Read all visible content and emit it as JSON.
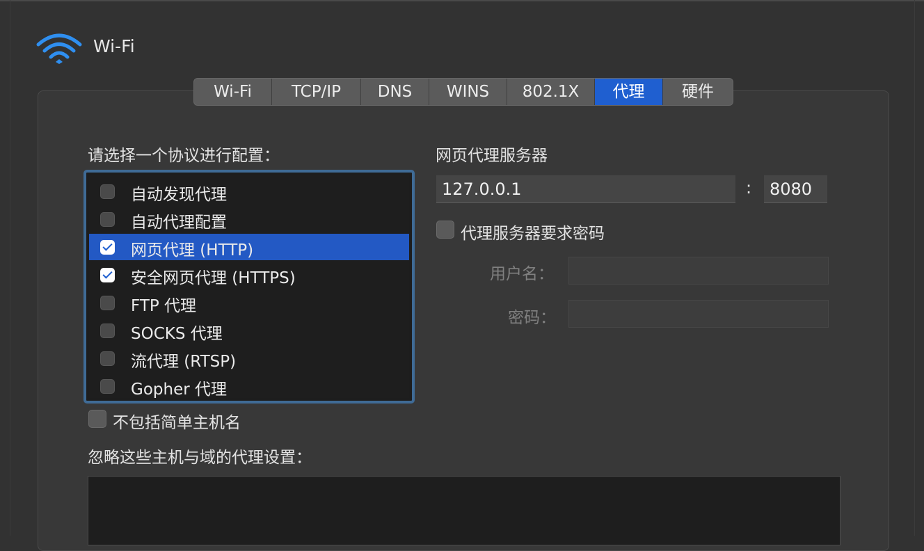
{
  "header": {
    "title": "Wi-Fi",
    "icon": "wifi-icon",
    "accent": "#2f8ff0"
  },
  "tabs": [
    {
      "label": "Wi-Fi",
      "active": false
    },
    {
      "label": "TCP/IP",
      "active": false
    },
    {
      "label": "DNS",
      "active": false
    },
    {
      "label": "WINS",
      "active": false
    },
    {
      "label": "802.1X",
      "active": false
    },
    {
      "label": "代理",
      "active": true
    },
    {
      "label": "硬件",
      "active": false
    }
  ],
  "protocols": {
    "heading": "请选择一个协议进行配置：",
    "items": [
      {
        "label": "自动发现代理",
        "checked": false,
        "selected": false
      },
      {
        "label": "自动代理配置",
        "checked": false,
        "selected": false
      },
      {
        "label": "网页代理 (HTTP)",
        "checked": true,
        "selected": true
      },
      {
        "label": "安全网页代理 (HTTPS)",
        "checked": true,
        "selected": false
      },
      {
        "label": "FTP 代理",
        "checked": false,
        "selected": false
      },
      {
        "label": "SOCKS 代理",
        "checked": false,
        "selected": false
      },
      {
        "label": "流代理 (RTSP)",
        "checked": false,
        "selected": false
      },
      {
        "label": "Gopher 代理",
        "checked": false,
        "selected": false
      }
    ]
  },
  "exclude_simple": {
    "label": "不包括简单主机名",
    "checked": false
  },
  "bypass": {
    "heading": "忽略这些主机与域的代理设置：",
    "value": ""
  },
  "proxy_server": {
    "heading": "网页代理服务器",
    "host": "127.0.0.1",
    "separator": ":",
    "port": "8080",
    "requires_password": {
      "label": "代理服务器要求密码",
      "checked": false
    },
    "username_label": "用户名：",
    "username": "",
    "password_label": "密码：",
    "password": ""
  },
  "colors": {
    "selection": "#2359c4",
    "active_tab": "#1f5fd0",
    "focus_ring": "#3f6b96"
  }
}
